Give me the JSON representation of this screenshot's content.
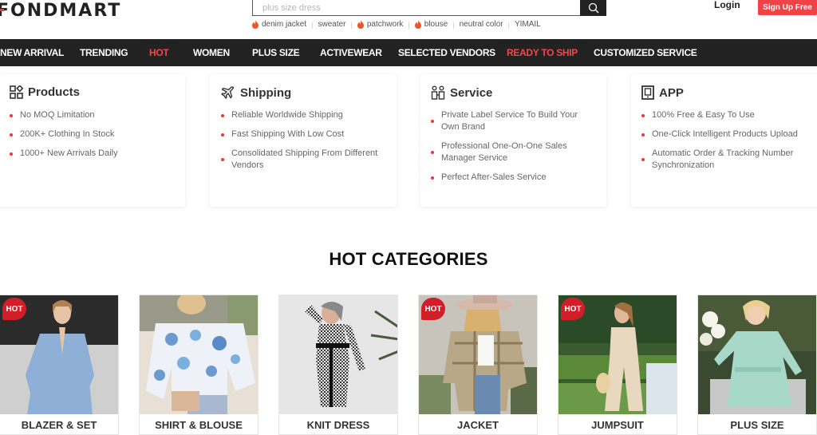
{
  "header": {
    "logo": "FONDMART",
    "search": {
      "placeholder": "plus size dress",
      "value": ""
    },
    "hot_terms": [
      {
        "label": "denim jacket",
        "hot": true
      },
      {
        "label": "sweater",
        "hot": false
      },
      {
        "label": "patchwork",
        "hot": true
      },
      {
        "label": "blouse",
        "hot": true
      },
      {
        "label": "neutral color",
        "hot": false
      },
      {
        "label": "YIMAIL",
        "hot": false
      }
    ],
    "login": "Login",
    "signup": "Sign Up Free"
  },
  "nav": {
    "items": [
      {
        "label": "NEW ARRIVAL",
        "highlight": false
      },
      {
        "label": "TRENDING",
        "highlight": false
      },
      {
        "label": "HOT",
        "highlight": true
      },
      {
        "label": "WOMEN",
        "highlight": false
      },
      {
        "label": "PLUS SIZE",
        "highlight": false
      },
      {
        "label": "ACTIVEWEAR",
        "highlight": false
      },
      {
        "label": "SELECTED VENDORS",
        "highlight": false
      },
      {
        "label": "READY TO SHIP",
        "highlight": true
      },
      {
        "label": "CUSTOMIZED SERVICE",
        "highlight": false
      }
    ]
  },
  "features": [
    {
      "title": "Products",
      "icon": "grid-icon",
      "items": [
        "No MOQ Limitation",
        "200K+ Clothing In Stock",
        "1000+ New Arrivals Daily"
      ]
    },
    {
      "title": "Shipping",
      "icon": "airplane-icon",
      "items": [
        "Reliable Worldwide Shipping",
        "Fast Shipping With Low Cost",
        "Consolidated Shipping From Different Vendors"
      ]
    },
    {
      "title": "Service",
      "icon": "people-icon",
      "items": [
        "Private Label Service To Build Your Own Brand",
        "Professional One-On-One Sales Manager Service",
        "Perfect After-Sales Service"
      ]
    },
    {
      "title": "APP",
      "icon": "phone-icon",
      "items": [
        "100% Free & Easy To Use",
        "One-Click Intelligent Products Upload",
        "Automatic Order & Tracking Number Synchronization"
      ]
    }
  ],
  "hot_categories": {
    "title": "HOT CATEGORIES",
    "badge": "HOT",
    "items": [
      {
        "label": "BLAZER & SET",
        "hot": true
      },
      {
        "label": "SHIRT & BLOUSE",
        "hot": false
      },
      {
        "label": "KNIT DRESS",
        "hot": false
      },
      {
        "label": "JACKET",
        "hot": true
      },
      {
        "label": "JUMPSUIT",
        "hot": true
      },
      {
        "label": "PLUS SIZE",
        "hot": false
      }
    ]
  },
  "colors": {
    "accent": "#f04347",
    "nav_bg": "#222222",
    "hot_badge": "#d11f2a"
  }
}
